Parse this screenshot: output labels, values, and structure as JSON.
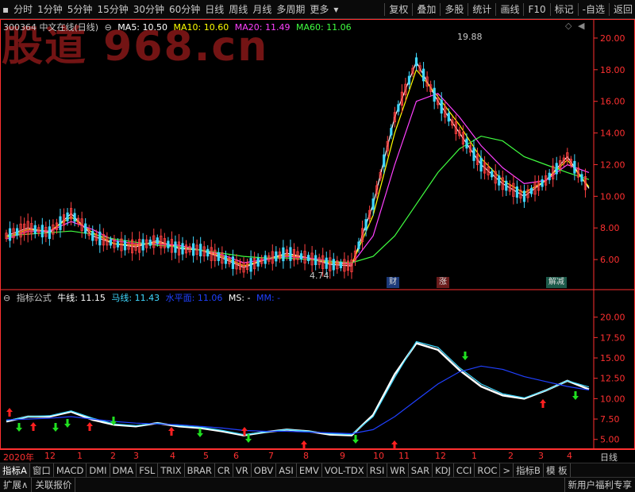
{
  "toolbar": {
    "left": [
      {
        "label": "分时",
        "active": false
      },
      {
        "label": "1分钟",
        "active": false
      },
      {
        "label": "5分钟",
        "active": false
      },
      {
        "label": "15分钟",
        "active": false
      },
      {
        "label": "30分钟",
        "active": false
      },
      {
        "label": "60分钟",
        "active": false
      },
      {
        "label": "日线",
        "active": false
      },
      {
        "label": "周线",
        "active": false
      },
      {
        "label": "月线",
        "active": false
      },
      {
        "label": "多周期",
        "active": false
      },
      {
        "label": "更多",
        "active": false
      }
    ],
    "right": [
      {
        "label": "复权"
      },
      {
        "label": "叠加"
      },
      {
        "label": "多股"
      },
      {
        "label": "统计"
      },
      {
        "label": "画线"
      },
      {
        "label": "F10"
      },
      {
        "label": "标记"
      },
      {
        "label": "-自选"
      },
      {
        "label": "返回"
      }
    ]
  },
  "watermark": "股道 968.cn",
  "main_legend": {
    "stock": "300364 中文在线(日线)",
    "ma5": "MA5: 10.50",
    "ma10": "MA10: 10.60",
    "ma20": "MA20: 11.49",
    "ma60": "MA60: 11.06"
  },
  "annotations": {
    "high": "19.88",
    "low": "4.74",
    "events": [
      {
        "label": "财",
        "color": "#4a78c8"
      },
      {
        "label": "涨",
        "color": "#c84a4a"
      },
      {
        "label": "解减",
        "color": "#4aa888"
      }
    ]
  },
  "indicator_legend": {
    "title": "指标公式",
    "niu": "牛线: 11.15",
    "ma": "马线: 11.43",
    "shuiping": "水平面: 11.06",
    "ms": "MS: -",
    "mm": "MM: -"
  },
  "date_axis": [
    "2020年",
    "12",
    "1",
    "2",
    "3",
    "4",
    "5",
    "6",
    "7",
    "8",
    "9",
    "10",
    "11",
    "12",
    "1",
    "2",
    "3",
    "4"
  ],
  "date_axis_right": "日线",
  "tabs": [
    "指标A",
    "窗口",
    "MACD",
    "DMI",
    "DMA",
    "FSL",
    "TRIX",
    "BRAR",
    "CR",
    "VR",
    "OBV",
    "ASI",
    "EMV",
    "VOL-TDX",
    "RSI",
    "WR",
    "SAR",
    "KDJ",
    "CCI",
    "ROC",
    ">",
    "指标B",
    "模 板"
  ],
  "status": {
    "expand": "扩展∧",
    "related": "关联报价",
    "promo": "新用户福利专享"
  },
  "colors": {
    "accent": "#ff3030",
    "ma5": "#ffffff",
    "ma10": "#ffff00",
    "ma20": "#ff40ff",
    "ma60": "#40ff40"
  },
  "chart_data": [
    {
      "type": "line",
      "title": "300364 中文在线(日线)",
      "ylim": [
        4.5,
        20.8
      ],
      "yticks": [
        6.0,
        8.0,
        10.0,
        12.0,
        14.0,
        16.0,
        18.0,
        20.0
      ],
      "series": [
        {
          "name": "MA5",
          "values": [
            7.5,
            8.0,
            7.7,
            8.9,
            7.5,
            7.0,
            6.8,
            7.2,
            6.7,
            6.6,
            6.1,
            5.5,
            6.0,
            6.4,
            6.1,
            5.7,
            5.6,
            9.5,
            15.0,
            18.5,
            16.0,
            14.0,
            12.0,
            10.8,
            10.0,
            11.0,
            12.5,
            10.5
          ]
        },
        {
          "name": "MA10",
          "values": [
            7.4,
            7.9,
            7.8,
            8.7,
            7.7,
            7.0,
            6.9,
            7.1,
            6.8,
            6.6,
            6.2,
            5.6,
            6.0,
            6.3,
            6.1,
            5.8,
            5.7,
            8.8,
            14.0,
            18.0,
            16.3,
            14.5,
            12.4,
            11.0,
            10.2,
            11.0,
            12.3,
            10.6
          ]
        },
        {
          "name": "MA20",
          "values": [
            7.3,
            7.8,
            7.8,
            8.4,
            7.9,
            7.2,
            7.0,
            7.0,
            6.9,
            6.6,
            6.3,
            5.8,
            6.0,
            6.2,
            6.1,
            5.9,
            5.7,
            7.5,
            12.0,
            16.0,
            16.5,
            15.0,
            13.2,
            11.8,
            10.8,
            11.0,
            12.0,
            11.5
          ]
        },
        {
          "name": "MA60",
          "values": [
            7.5,
            7.6,
            7.7,
            7.8,
            7.6,
            7.3,
            7.1,
            6.9,
            6.8,
            6.6,
            6.4,
            6.2,
            6.1,
            6.1,
            6.0,
            5.9,
            5.8,
            6.2,
            7.5,
            9.5,
            11.5,
            13.0,
            13.8,
            13.5,
            12.5,
            12.0,
            11.5,
            11.06
          ]
        }
      ]
    },
    {
      "type": "line",
      "title": "指标公式",
      "ylim": [
        4.0,
        22.5
      ],
      "yticks": [
        5.0,
        7.5,
        10.0,
        12.5,
        15.0,
        17.5,
        20.0
      ],
      "series": [
        {
          "name": "牛线",
          "values": [
            7.2,
            7.8,
            7.8,
            8.4,
            7.4,
            6.8,
            6.6,
            7.0,
            6.6,
            6.4,
            6.0,
            5.5,
            5.9,
            6.2,
            6.0,
            5.6,
            5.5,
            8.0,
            13.0,
            16.8,
            16.0,
            13.5,
            11.5,
            10.4,
            10.0,
            11.0,
            12.2,
            11.15
          ]
        },
        {
          "name": "马线",
          "values": [
            7.3,
            7.8,
            7.9,
            8.5,
            7.6,
            6.9,
            6.7,
            7.0,
            6.7,
            6.5,
            6.1,
            5.6,
            5.9,
            6.2,
            6.0,
            5.7,
            5.6,
            7.8,
            12.6,
            17.0,
            16.3,
            13.8,
            11.8,
            10.6,
            10.1,
            11.0,
            12.2,
            11.43
          ]
        },
        {
          "name": "水平面",
          "values": [
            7.4,
            7.5,
            7.6,
            7.8,
            7.5,
            7.2,
            7.0,
            6.9,
            6.8,
            6.6,
            6.4,
            6.1,
            6.0,
            6.0,
            5.9,
            5.8,
            5.7,
            6.2,
            7.8,
            9.8,
            11.8,
            13.3,
            14.0,
            13.6,
            12.7,
            12.1,
            11.5,
            11.06
          ]
        }
      ]
    }
  ]
}
